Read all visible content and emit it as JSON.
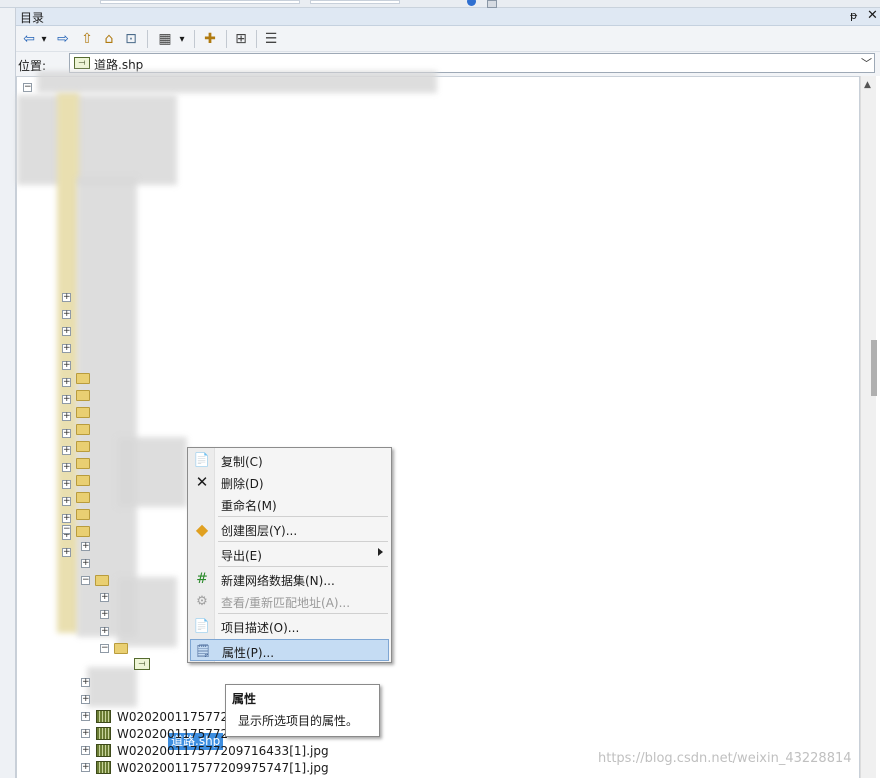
{
  "panel": {
    "title": "目录",
    "pin_glyph": "ᵽ",
    "close_glyph": "✕"
  },
  "toolbar": {
    "back": "⇦",
    "dropdown": "▾",
    "forward": "⇨",
    "up": "⇧",
    "home": "⌂",
    "connect": "⊡",
    "grid_view": "▦",
    "grid_dropdown": "▾",
    "new_item": "✚",
    "tree_view": "⊞",
    "details": "☰"
  },
  "location": {
    "label": "位置:",
    "value": "道路.shp"
  },
  "tree": {
    "selected_item": "道路.shp",
    "raster_items": [
      "W020200117577207",
      "W0202001175772",
      "W020200117577209716433[1].jpg",
      "W020200117577209975747[1].jpg"
    ]
  },
  "context_menu": {
    "items": [
      {
        "label": "复制(C)",
        "icon": "copy-icon",
        "disabled": false
      },
      {
        "label": "删除(D)",
        "icon": "delete-icon",
        "disabled": false
      },
      {
        "label": "重命名(M)",
        "icon": "",
        "disabled": false
      },
      {
        "label": "创建图层(Y)...",
        "icon": "layer-icon",
        "disabled": false
      },
      {
        "label": "导出(E)",
        "icon": "",
        "disabled": false,
        "submenu": true
      },
      {
        "label": "新建网络数据集(N)...",
        "icon": "network-icon",
        "disabled": false
      },
      {
        "label": "查看/重新匹配地址(A)...",
        "icon": "address-icon",
        "disabled": true
      },
      {
        "label": "项目描述(O)...",
        "icon": "description-icon",
        "disabled": false
      },
      {
        "label": "属性(P)...",
        "icon": "properties-icon",
        "disabled": false,
        "highlighted": true
      }
    ]
  },
  "tooltip": {
    "title": "属性",
    "description": "显示所选项目的属性。"
  },
  "watermark": "https://blog.csdn.net/weixin_43228814"
}
